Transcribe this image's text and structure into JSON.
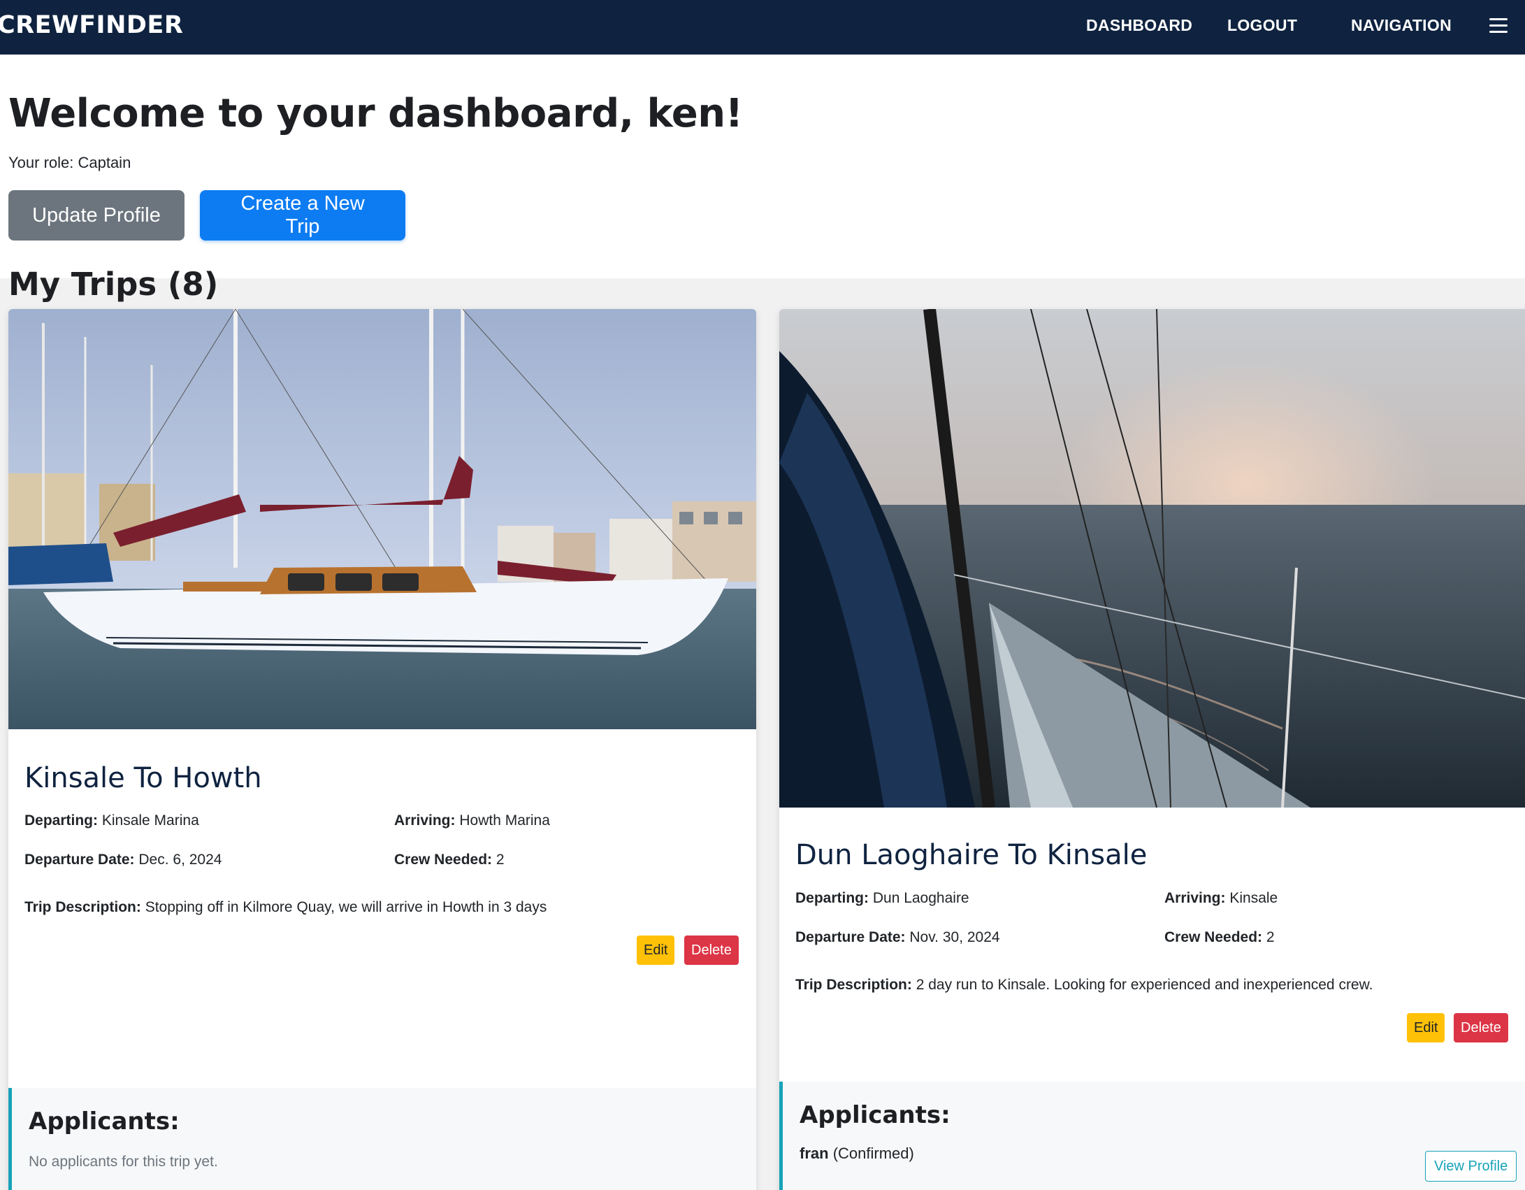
{
  "navbar": {
    "brand": "CREWFINDER",
    "links": {
      "dashboard": "DASHBOARD",
      "logout": "LOGOUT",
      "navigation": "NAVIGATION"
    },
    "menu_icon": "hamburger-menu-icon"
  },
  "header": {
    "welcome": "Welcome to your dashboard, ken!",
    "role": "Your role: Captain",
    "update_profile_label": "Update Profile",
    "create_trip_label": "Create a New Trip"
  },
  "trips_heading": "My Trips (8)",
  "trips": [
    {
      "title": "Kinsale To Howth",
      "departing_label": "Departing:",
      "departing": "Kinsale Marina",
      "arriving_label": "Arriving:",
      "arriving": "Howth Marina",
      "date_label": "Departure Date:",
      "date": "Dec. 6, 2024",
      "crew_label": "Crew Needed:",
      "crew": "2",
      "desc_label": "Trip Description:",
      "desc": "Stopping off in Kilmore Quay, we will arrive in Howth in 3 days",
      "edit_label": "Edit",
      "delete_label": "Delete",
      "applicants_title": "Applicants:",
      "applicants_empty": "No applicants for this trip yet."
    },
    {
      "title": "Dun Laoghaire To Kinsale",
      "departing_label": "Departing:",
      "departing": "Dun Laoghaire",
      "arriving_label": "Arriving:",
      "arriving": "Kinsale",
      "date_label": "Departure Date:",
      "date": "Nov. 30, 2024",
      "crew_label": "Crew Needed:",
      "crew": "2",
      "desc_label": "Trip Description:",
      "desc": "2 day run to Kinsale. Looking for experienced and inexperienced crew.",
      "edit_label": "Edit",
      "delete_label": "Delete",
      "applicants_title": "Applicants:",
      "applicant_name": "fran",
      "applicant_status": "(Confirmed)",
      "view_profile_label": "View Profile"
    }
  ],
  "colors": {
    "navbar": "#0f2340",
    "primary": "#0d7cf2",
    "secondary": "#6c757d",
    "warning": "#ffc107",
    "danger": "#dc3545",
    "info": "#17a2b8"
  }
}
